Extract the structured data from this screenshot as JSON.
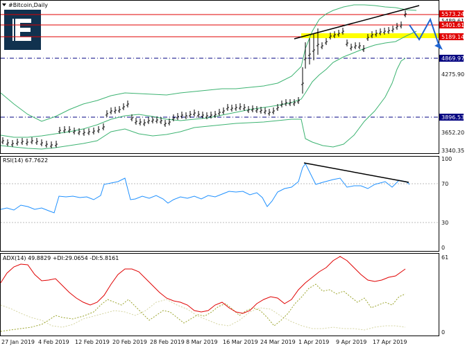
{
  "window": {
    "title": "#Bitcoin,Daily",
    "menu_icon": "triangle-down-icon",
    "logo_icon": "broker-logo-icon"
  },
  "colors": {
    "frame": "#000000",
    "bullish_box": "#ffffff",
    "grid_dash": "#000080",
    "band": "#3cb371",
    "resistance": "#e00000",
    "support_fill": "#ffff00",
    "arrow": "#1e64d2",
    "rsi_line": "#1e90ff",
    "adx_line": "#e00000",
    "plus_di": "#9aa32a",
    "minus_di": "#d4d4a0",
    "price_tag_red": "#e00000",
    "price_tag_navy": "#000080"
  },
  "price_panel": {
    "axis_labels": [
      "5573.24",
      "5489.61",
      "5401.61",
      "5189.14",
      "4869.97",
      "4275.90",
      "3896.53",
      "3652.20",
      "3340.35"
    ],
    "tags": [
      {
        "text": "5573.24",
        "kind": "red"
      },
      {
        "text": "5401.61",
        "kind": "red"
      },
      {
        "text": "5189.14",
        "kind": "red"
      },
      {
        "text": "4869.97",
        "kind": "navy"
      },
      {
        "text": "3896.53",
        "kind": "navy"
      }
    ]
  },
  "rsi_panel": {
    "label": "RSI(14) 67.7622",
    "axis_labels": [
      "100",
      "70",
      "30",
      "0"
    ]
  },
  "adx_panel": {
    "label": "ADX(14) 49.8829 +DI:29.0654 -DI:5.8161",
    "axis_labels": [
      "61",
      "0"
    ]
  },
  "x_axis": {
    "labels": [
      "27 Jan 2019",
      "4 Feb 2019",
      "12 Feb 2019",
      "20 Feb 2019",
      "28 Feb 2019",
      "8 Mar 2019",
      "16 Mar 2019",
      "24 Mar 2019",
      "1 Apr 2019",
      "9 Apr 2019",
      "17 Apr 2019"
    ]
  }
}
